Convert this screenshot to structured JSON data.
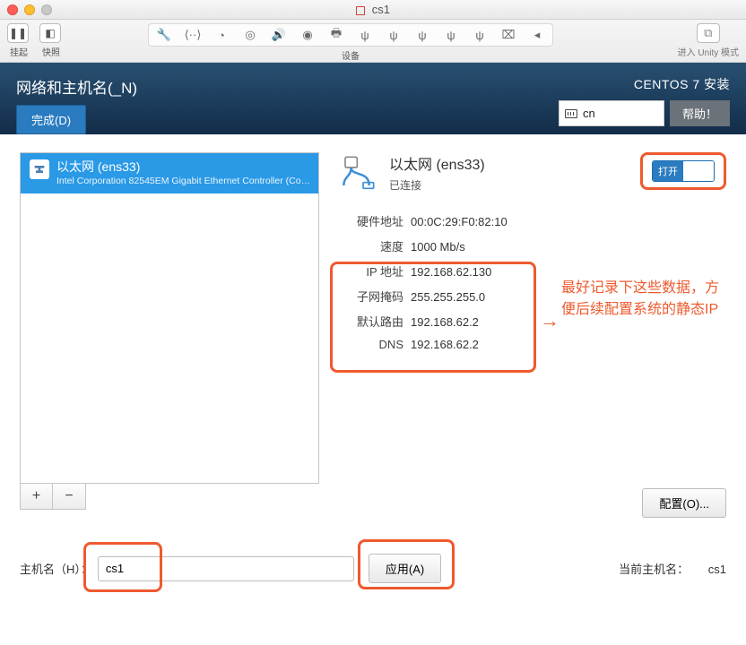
{
  "window": {
    "title": "cs1"
  },
  "vmtoolbar": {
    "pause_label": "挂起",
    "snapshot_label": "快照",
    "devices_label": "设备",
    "unity_label": "进入 Unity 模式"
  },
  "header": {
    "page_title": "网络和主机名(_N)",
    "done_btn": "完成(D)",
    "install_title": "CENTOS 7 安装",
    "lang_code": "cn",
    "help_btn": "帮助！"
  },
  "device_list": {
    "items": [
      {
        "name": "以太网 (ens33)",
        "subtitle": "Intel Corporation 82545EM Gigabit Ethernet Controller (Copper)"
      }
    ]
  },
  "details": {
    "title": "以太网 (ens33)",
    "status": "已连接",
    "toggle_on_label": "打开",
    "rows": {
      "hw_addr_k": "硬件地址",
      "hw_addr_v": "00:0C:29:F0:82:10",
      "speed_k": "速度",
      "speed_v": "1000 Mb/s",
      "ip_k": "IP 地址",
      "ip_v": "192.168.62.130",
      "mask_k": "子网掩码",
      "mask_v": "255.255.255.0",
      "gw_k": "默认路由",
      "gw_v": "192.168.62.2",
      "dns_k": "DNS",
      "dns_v": "192.168.62.2"
    },
    "configure_btn": "配置(O)..."
  },
  "annotation": {
    "text": "最好记录下这些数据，方便后续配置系统的静态IP"
  },
  "hostname": {
    "label": "主机名（H）：",
    "value": "cs1",
    "apply_btn": "应用(A)",
    "current_label": "当前主机名：",
    "current_value": "cs1"
  }
}
